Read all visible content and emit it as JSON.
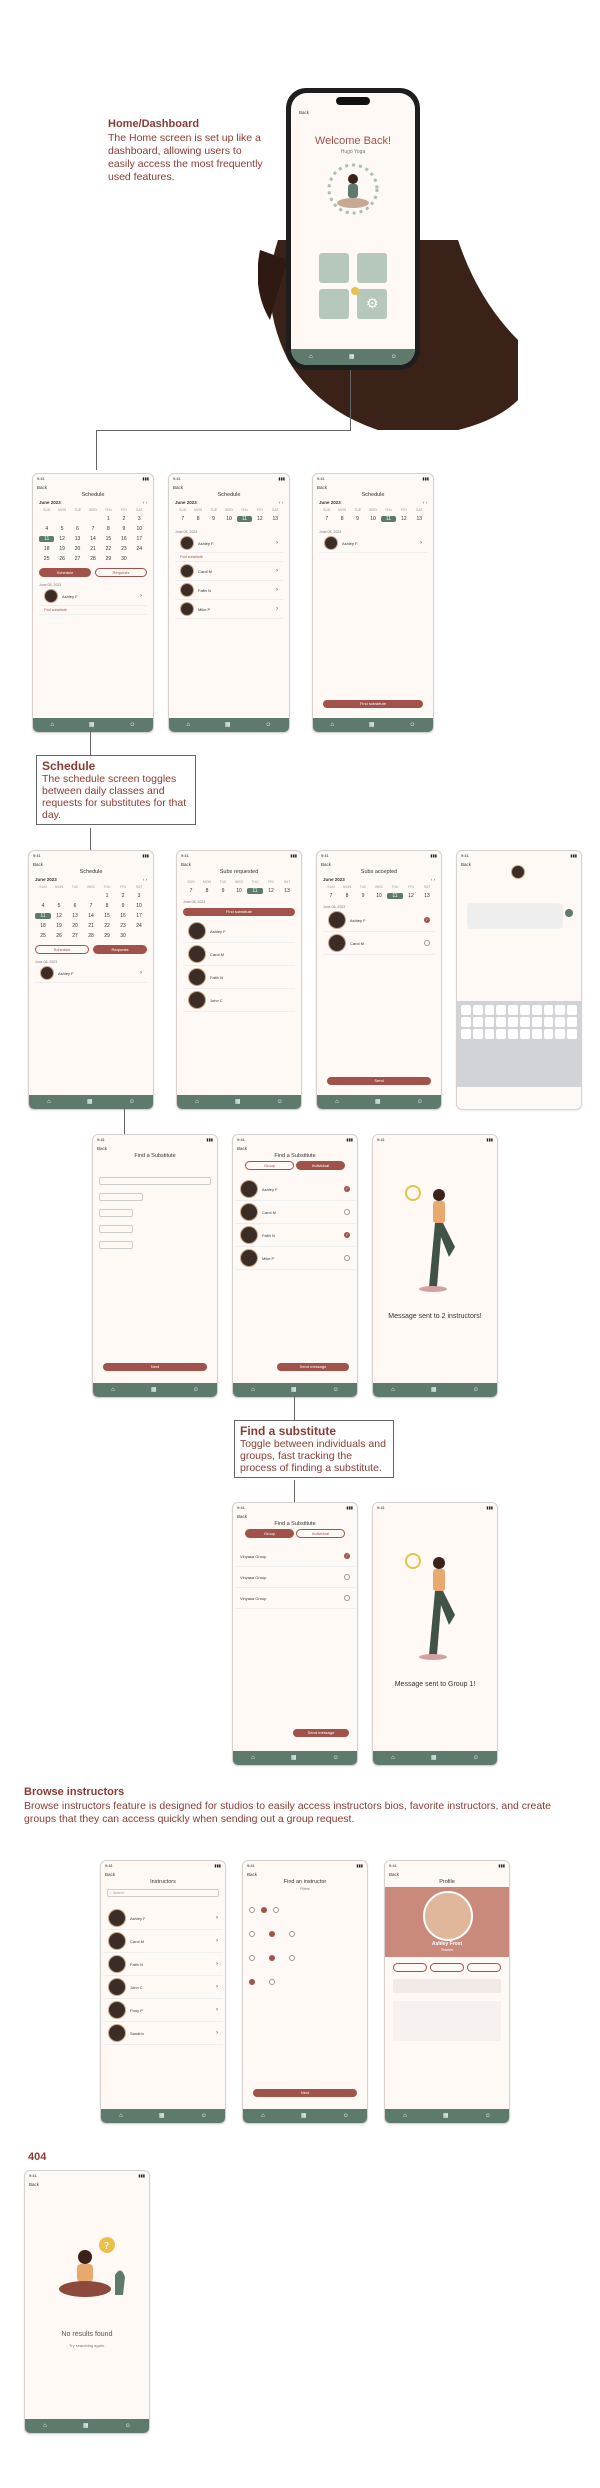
{
  "home": {
    "heading": "Home/Dashboard",
    "description": "The Home screen is set up like a dashboard, allowing users to easily access the most frequently used features.",
    "welcome": "Welcome Back!",
    "user": "Hugo Yoga"
  },
  "schedule": {
    "heading": "Schedule",
    "description": "The schedule screen toggles between daily classes and requests for substitutes for that day.",
    "title": "Schedule",
    "month": "June 2023",
    "weekdays": [
      "SUN",
      "MON",
      "TUE",
      "WED",
      "THU",
      "FRI",
      "SAT"
    ],
    "weeks": [
      [
        "",
        "",
        "",
        "",
        "1",
        "2",
        "3"
      ],
      [
        "4",
        "5",
        "6",
        "7",
        "8",
        "9",
        "10"
      ],
      [
        "11",
        "12",
        "13",
        "14",
        "15",
        "16",
        "17"
      ],
      [
        "18",
        "19",
        "20",
        "21",
        "22",
        "23",
        "24"
      ],
      [
        "25",
        "26",
        "27",
        "28",
        "29",
        "30",
        ""
      ]
    ],
    "week_strip": [
      "7",
      "8",
      "9",
      "10",
      "11",
      "12",
      "13"
    ],
    "tab_schedule": "Schedule",
    "tab_requests": "Requests",
    "subs_requested": "Subs requested",
    "subs_accepted": "Subs accepted",
    "date_label": "June 08, 2023",
    "find_sub_btn": "Find substitute",
    "send_btn": "Send"
  },
  "find_sub": {
    "heading": "Find a substitute",
    "description": "Toggle between individuals and groups, fast tracking the process of finding a substitute.",
    "title": "Find a Substitute",
    "tab_group": "Group",
    "tab_individual": "Individual",
    "message_instructors": "Message sent to 2 instructors!",
    "message_group": "Message sent to Group 1!",
    "send_message": "Send message",
    "next": "Next"
  },
  "instructors": {
    "ashley": "Ashley F",
    "carol": "Carol M",
    "faith": "Faith N",
    "mike": "Mike P",
    "john": "John C",
    "pooy": "Pooy P",
    "sandrin": "Sandrin",
    "group1": "Vinyasa Group",
    "group2": "Vinyasa Group",
    "group3": "Vinyasa Group"
  },
  "browse": {
    "heading": "Browse instructors",
    "description": "Browse instructors feature is designed for studios to easily access instructors bios, favorite instructors, and create groups that they can access quickly when sending out a group request.",
    "instructors_title": "Instructors",
    "search": "Search",
    "find_title": "Find an instructor",
    "filters": "Filters",
    "profile_title": "Profile",
    "profile_name": "Ashley Frost",
    "profile_role": "Teacher"
  },
  "not_found": {
    "heading": "404",
    "message": "No results found",
    "hint": "Try searching again."
  },
  "common": {
    "back": "Back",
    "time": "9:41"
  }
}
